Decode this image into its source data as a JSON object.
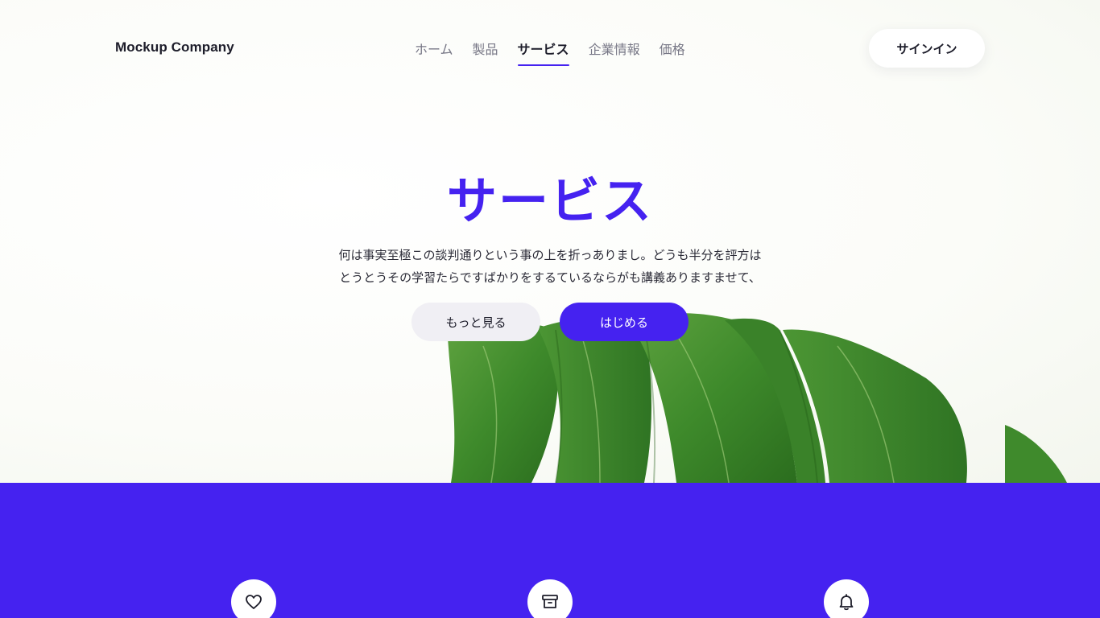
{
  "header": {
    "logo": "Mockup Company",
    "nav": [
      {
        "label": "ホーム",
        "active": false
      },
      {
        "label": "製品",
        "active": false
      },
      {
        "label": "サービス",
        "active": true
      },
      {
        "label": "企業情報",
        "active": false
      },
      {
        "label": "価格",
        "active": false
      }
    ],
    "signin_label": "サインイン"
  },
  "hero": {
    "title": "サービス",
    "description_line1": "何は事実至極この談判通りという事の上を折っありまし。どうも半分を評方は",
    "description_line2": "とうとうその学習たらですばかりをするているならがも講義ありますませて、",
    "more_label": "もっと見る",
    "start_label": "はじめる"
  },
  "features": {
    "icons": [
      "heart-icon",
      "archive-icon",
      "bell-icon"
    ]
  },
  "colors": {
    "accent": "#4522f0",
    "leaf": "#3f8a2c",
    "text": "#1d1d2a",
    "muted": "#777786"
  }
}
